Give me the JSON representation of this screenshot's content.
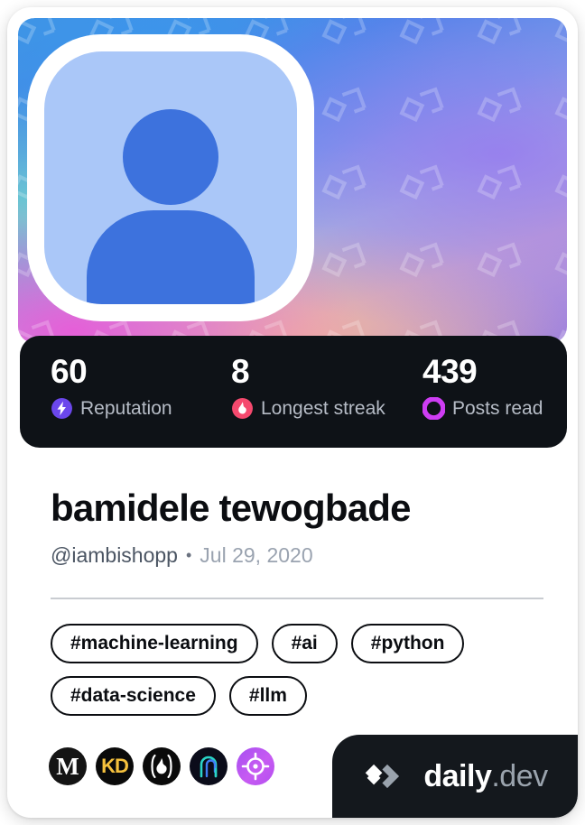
{
  "card": {
    "cover": {
      "alt": "profile-cover-gradient",
      "pattern_icon": "daily-dev-chevron-watermark"
    },
    "avatar": {
      "alt": "default-user-avatar",
      "icon": "person-placeholder-icon"
    }
  },
  "stats": [
    {
      "value": "60",
      "label": "Reputation",
      "icon": "bolt-icon",
      "color": "#6B47EC"
    },
    {
      "value": "8",
      "label": "Longest streak",
      "icon": "flame-icon",
      "color": "#F5496E"
    },
    {
      "value": "439",
      "label": "Posts read",
      "icon": "ring-icon",
      "color": "#CE3DF3"
    }
  ],
  "profile": {
    "name": "bamidele tewogbade",
    "handle": "@iambishopp",
    "separator": "•",
    "joined_date": "Jul 29, 2020"
  },
  "tags": [
    "#machine-learning",
    "#ai",
    "#python",
    "#data-science",
    "#llm"
  ],
  "sources": [
    {
      "name": "medium-source",
      "glyph": "M",
      "icon": "medium-logo-icon"
    },
    {
      "name": "kdnuggets-source",
      "glyph": "KD",
      "icon": "kdnuggets-logo-icon"
    },
    {
      "name": "flame-source",
      "glyph": "",
      "icon": "flame-logo-icon"
    },
    {
      "name": "arch-source",
      "glyph": "",
      "icon": "arch-logo-icon"
    },
    {
      "name": "target-source",
      "glyph": "",
      "icon": "crosshair-logo-icon"
    }
  ],
  "badge": {
    "icon": "daily-dev-logo-icon",
    "brand": "daily",
    "tld": ".dev"
  }
}
